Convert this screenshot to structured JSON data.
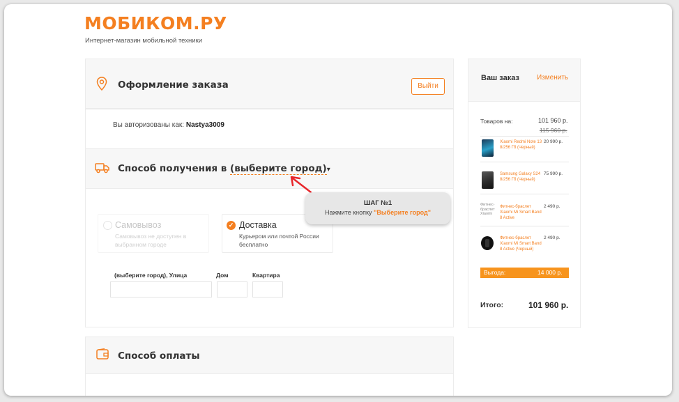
{
  "header": {
    "logo": "МОБИКОМ.РУ",
    "tagline": "Интернет-магазин мобильной техники"
  },
  "checkout": {
    "title": "Оформление заказа",
    "logout_label": "Выйти",
    "auth_prefix": "Вы авторизованы как:",
    "username": "Nastya3009"
  },
  "delivery": {
    "title_prefix": "Способ получения в",
    "city_link": "(выберите город)",
    "arrow_glyph": "▾",
    "pickup": {
      "title": "Самовывоз",
      "desc": "Самовывоз не доступен в выбранном городе"
    },
    "courier": {
      "title": "Доставка",
      "desc": "Курьером или почтой России бесплатно"
    },
    "fields": {
      "street_label": "(выберите город), Улица",
      "house_label": "Дом",
      "apartment_label": "Квартира"
    }
  },
  "tooltip": {
    "step": "ШАГ №1",
    "text_prefix": "Нажмите кнопку",
    "button_ref": "\"Выберите город\""
  },
  "payment": {
    "title": "Способ оплаты"
  },
  "sidebar": {
    "title": "Ваш заказ",
    "edit_label": "Изменить",
    "goods_label": "Товаров на:",
    "goods_total": "101 960 р.",
    "goods_old_total": "115 960 р.",
    "items": [
      {
        "name": "Xiaomi Redmi Note 13 8/256 Гб (Черный)",
        "price": "20 990 р."
      },
      {
        "name": "Samsung Galaxy S24 8/256 Гб (Черный)",
        "price": "75 990 р."
      },
      {
        "name": "Фитнес-браслет Xiaomi Mi Smart Band 8 Active",
        "price": "2 490 р."
      },
      {
        "name": "Фитнес-браслет Xiaomi Mi Smart Band 8 Active (Черный)",
        "price": "2 490 р."
      }
    ],
    "broken_image_text": "Фитнес-браслет Xiaomi",
    "benefit_label": "Выгода:",
    "benefit_value": "14 000 р.",
    "total_label": "Итого:",
    "total_value": "101 960 р."
  },
  "colors": {
    "accent": "#f47f20",
    "benefit_bg": "#f7941d",
    "card_bg": "#f7f7f7",
    "arrow": "#e8262b"
  }
}
